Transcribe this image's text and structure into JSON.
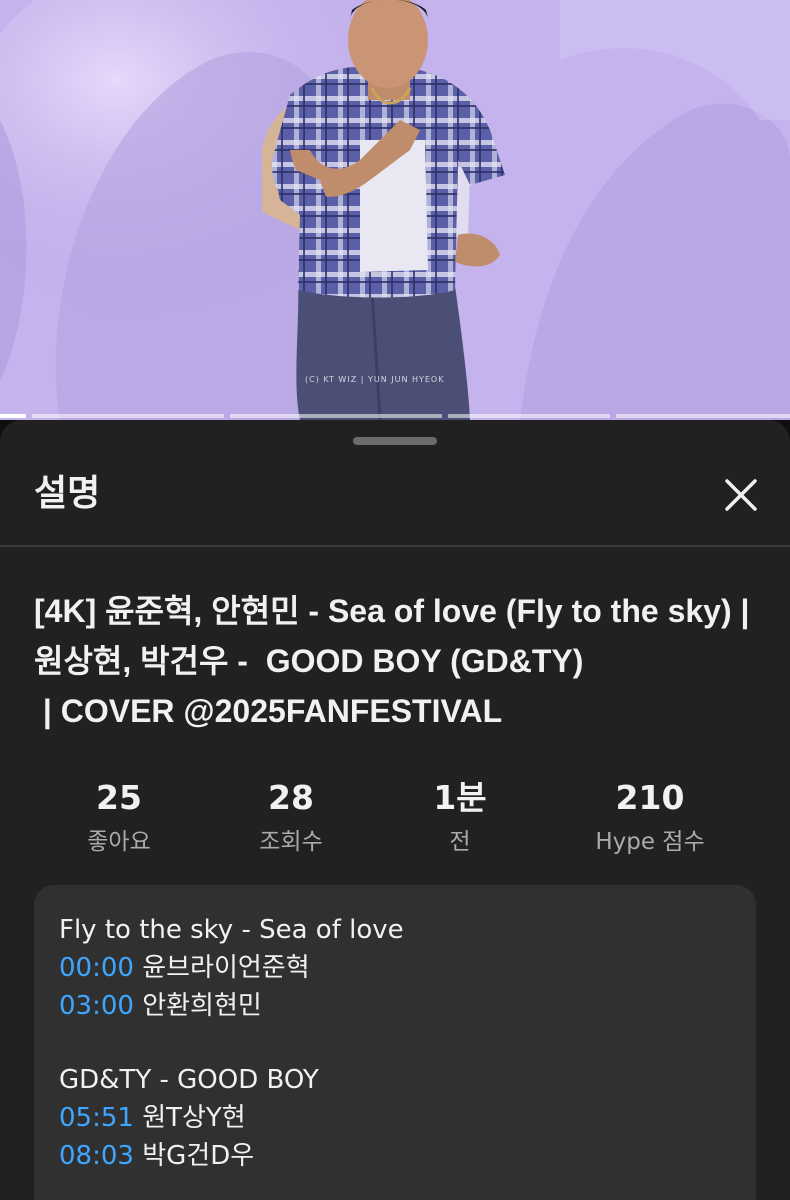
{
  "video": {
    "thumbnail_icon": "performer-on-stage-image",
    "watermark": "(C) KT WIZ  |  YUN JUN HYEOK"
  },
  "sheet": {
    "title": "설명",
    "close_icon": "close-icon",
    "video_title": "[4K] 윤준혁, 안현민 - Sea of love (Fly to the sky) | 원상현, 박건우 -  GOOD BOY (GD&TY)\n | COVER @2025FANFESTIVAL"
  },
  "stats": [
    {
      "value": "25",
      "label": "좋아요"
    },
    {
      "value": "28",
      "label": "조회수"
    },
    {
      "value": "1분",
      "label": "전"
    },
    {
      "value": "210",
      "label": "Hype 점수"
    }
  ],
  "description": {
    "sections": [
      {
        "heading": "Fly to the sky - Sea of love",
        "chapters": [
          {
            "time": "00:00",
            "text": "윤브라이언준혁"
          },
          {
            "time": "03:00",
            "text": "안환희현민"
          }
        ]
      },
      {
        "heading": "GD&TY - GOOD BOY",
        "chapters": [
          {
            "time": "05:51",
            "text": "원T상Y현"
          },
          {
            "time": "08:03",
            "text": "박G건D우"
          }
        ]
      }
    ]
  },
  "colors": {
    "background": "#0f0f0f",
    "sheet": "#212121",
    "description_box": "#303030",
    "timestamp_link": "#3ea6ff",
    "secondary_text": "#aaaaaa"
  }
}
